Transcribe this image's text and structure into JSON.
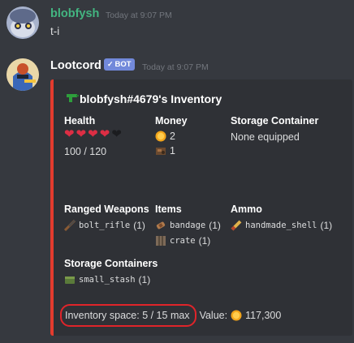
{
  "messages": [
    {
      "username": "blobfysh",
      "timestamp": "Today at 9:07 PM",
      "text": "t-i",
      "username_color": "#43b581"
    },
    {
      "username": "Lootcord",
      "badge": "BOT",
      "timestamp": "Today at 9:07 PM",
      "username_color": "#ffffff"
    }
  ],
  "embed": {
    "accent_color": "#e33b2e",
    "title": "blobfysh#4679's Inventory",
    "health": {
      "label": "Health",
      "value": "100 / 120",
      "hearts_filled": 4,
      "hearts_total": 5
    },
    "money": {
      "label": "Money",
      "coins": "2",
      "second_currency": "1"
    },
    "storage_container": {
      "label": "Storage Container",
      "value": "None equipped"
    },
    "ranged_weapons": {
      "label": "Ranged Weapons",
      "items": [
        {
          "name": "bolt_rifle",
          "count": "(1)",
          "icon": "rifle-icon"
        }
      ]
    },
    "items": {
      "label": "Items",
      "list": [
        {
          "name": "bandage",
          "count": "(1)",
          "icon": "bandage-icon"
        },
        {
          "name": "crate",
          "count": "(1)",
          "icon": "crate-icon"
        }
      ]
    },
    "ammo": {
      "label": "Ammo",
      "items": [
        {
          "name": "handmade_shell",
          "count": "(1)",
          "icon": "shell-icon"
        }
      ]
    },
    "storage_containers": {
      "label": "Storage Containers",
      "items": [
        {
          "name": "small_stash",
          "count": "(1)",
          "icon": "stash-icon"
        }
      ]
    },
    "footer": {
      "space_text": "Inventory space: 5 / 15 max",
      "value_label": "Value:",
      "value_amount": "117,300"
    }
  }
}
